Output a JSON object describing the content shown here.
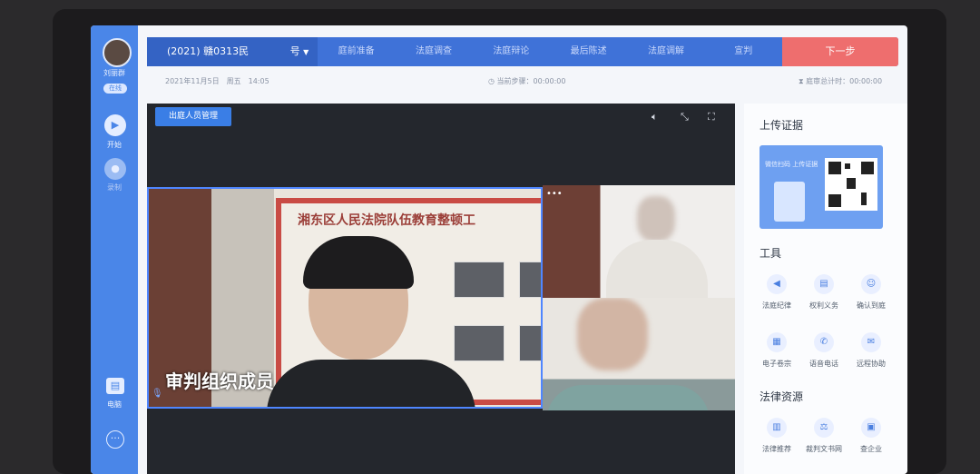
{
  "user": {
    "name": "刘丽群",
    "status": "在线"
  },
  "rail": {
    "start_label": "开始",
    "record_label": "录制",
    "electronic_label": "电脑",
    "more_icon": "ellipsis-icon"
  },
  "topbar": {
    "case_number": "(2021) 赣0313民",
    "case_suffix": "号",
    "steps": [
      "庭前准备",
      "法庭调查",
      "法庭辩论",
      "最后陈述",
      "法庭调解",
      "宣判"
    ],
    "next_label": "下一步"
  },
  "info": {
    "date": "2021年11月5日　周五　14:05",
    "current_step": "当前步骤：00:00:00",
    "total_time": "庭审总计时：00:00:00"
  },
  "video": {
    "manage_button": "出庭人员管理",
    "banner_text": "湘东区人民法院队伍教育整顿工",
    "main_label": "审判组织成员"
  },
  "panel": {
    "upload_title": "上传证据",
    "upload_hint": "微信扫码 上传证据",
    "tools_title": "工具",
    "tools": [
      {
        "label": "法庭纪律",
        "icon": "speaker-icon"
      },
      {
        "label": "权利义务",
        "icon": "document-icon"
      },
      {
        "label": "确认到庭",
        "icon": "person-icon"
      },
      {
        "label": "电子卷宗",
        "icon": "folder-icon"
      },
      {
        "label": "语音电话",
        "icon": "phone-icon"
      },
      {
        "label": "远程协助",
        "icon": "chat-icon"
      }
    ],
    "legal_title": "法律资源",
    "legal": [
      {
        "label": "法律推荐",
        "icon": "book-icon"
      },
      {
        "label": "裁判文书网",
        "icon": "gavel-icon"
      },
      {
        "label": "查企业",
        "icon": "building-icon"
      }
    ]
  },
  "colors": {
    "accent": "#4a86e8",
    "next_button": "#ee6e6e",
    "topbar": "#3f72d8"
  }
}
